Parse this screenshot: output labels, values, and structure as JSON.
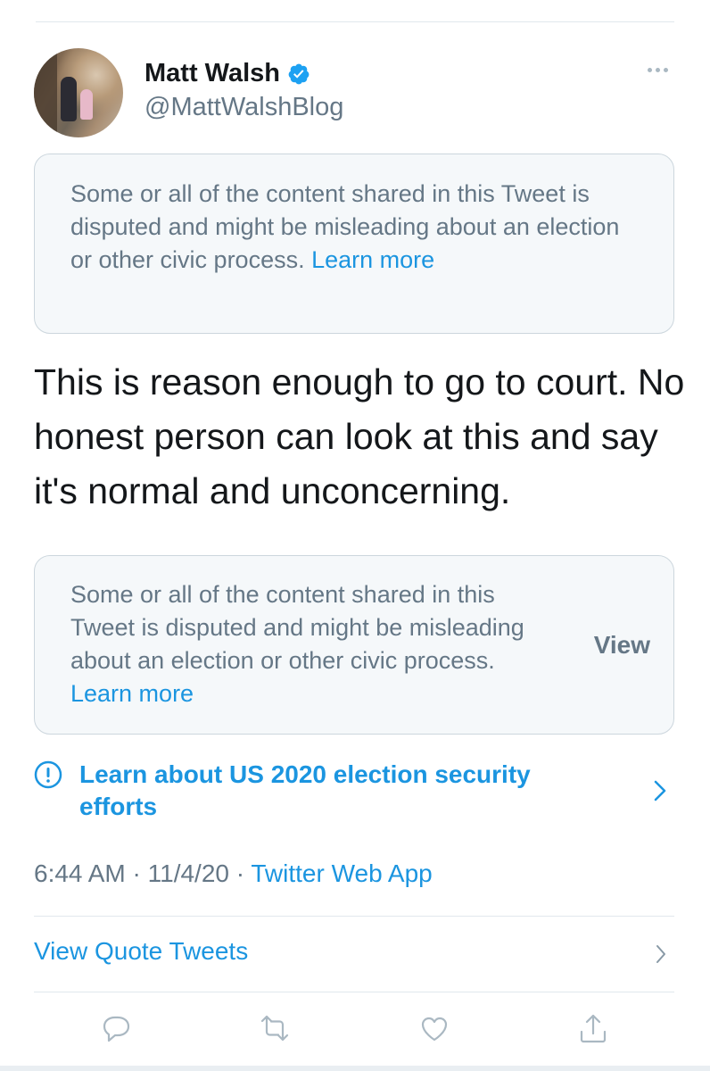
{
  "user": {
    "name": "Matt Walsh",
    "handle": "@MattWalshBlog"
  },
  "notice_top": {
    "text": "Some or all of the content shared in this Tweet is disputed and might be misleading about an election or other civic process.",
    "link": "Learn more"
  },
  "tweet": {
    "text": "This is reason enough to go to court. No honest person can look at this and say it's normal and unconcerning."
  },
  "notice_quoted": {
    "text": "Some or all of the content shared in this Tweet is disputed and might be misleading about an election or other civic process.",
    "link": "Learn more",
    "view_label": "View"
  },
  "election": {
    "label": "Learn about US 2020 election security efforts"
  },
  "meta": {
    "time": "6:44 AM",
    "date": "11/4/20",
    "source": "Twitter Web App",
    "separator": "·"
  },
  "quote_tweets": {
    "label": "View Quote Tweets"
  },
  "icons": {
    "verified": "verified-badge-icon",
    "more": "more-icon",
    "alert": "alert-circle-icon",
    "reply": "reply-icon",
    "retweet": "retweet-icon",
    "like": "like-icon",
    "share": "share-icon"
  },
  "colors": {
    "accent": "#1b95e0",
    "secondary_text": "#657786",
    "notice_bg": "#f5f8fa",
    "border": "#ccd6dd"
  }
}
